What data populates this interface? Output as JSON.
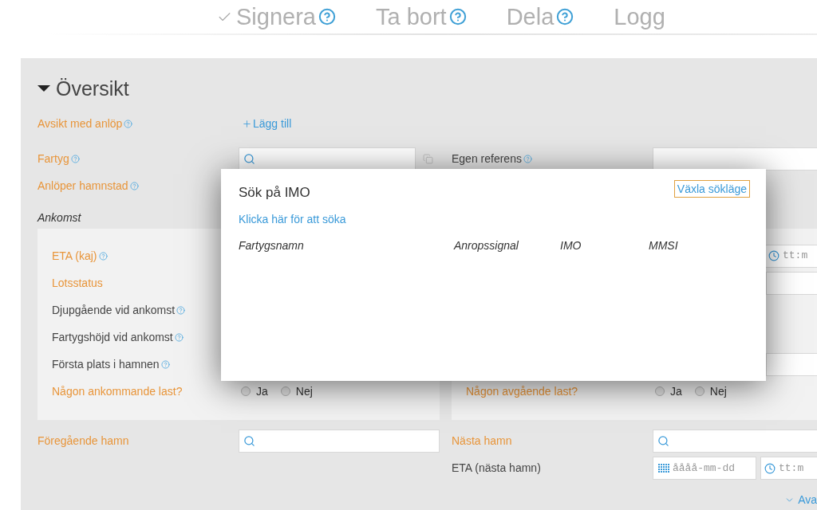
{
  "toolbar": {
    "actions": [
      {
        "label": "Signera",
        "checked": true,
        "help": true
      },
      {
        "label": "Ta bort",
        "checked": false,
        "help": true
      },
      {
        "label": "Dela",
        "checked": false,
        "help": true
      },
      {
        "label": "Logg",
        "checked": false,
        "help": false
      }
    ]
  },
  "section": {
    "title": "Översikt",
    "expanded": true,
    "rows": [
      {
        "left": {
          "label": "Avsikt med anlöp",
          "required": true,
          "help": true,
          "control": {
            "kind": "add",
            "label": "Lägg till"
          }
        }
      },
      {
        "left": {
          "label": "Fartyg",
          "required": true,
          "help": true,
          "control": {
            "kind": "search",
            "copy_button": true
          }
        },
        "right": {
          "label": "Egen referens",
          "required": false,
          "help": true,
          "control": {
            "kind": "text"
          }
        }
      },
      {
        "left": {
          "label": "Anlöper hamnstad",
          "required": true,
          "help": true
        }
      }
    ],
    "arrival": {
      "title": "Ankomst",
      "fields": [
        {
          "label": "ETA (kaj)",
          "required": true,
          "help": true
        },
        {
          "label": "Lotsstatus",
          "required": true,
          "help": false
        },
        {
          "label": "Djupgående vid ankomst",
          "required": false,
          "help": true
        },
        {
          "label": "Fartygshöjd vid ankomst",
          "required": false,
          "help": true
        },
        {
          "label": "Första plats i hamnen",
          "required": false,
          "help": true
        },
        {
          "label": "Någon ankommande last?",
          "required": true,
          "help": false,
          "control": {
            "kind": "radio",
            "options": [
              {
                "label": "Ja",
                "selected": false
              },
              {
                "label": "Nej",
                "selected": false
              }
            ]
          }
        }
      ]
    },
    "departure": {
      "fields": [
        {
          "control": {
            "kind": "time",
            "placeholder": "tt:m"
          }
        },
        {
          "control": {
            "kind": "text"
          }
        },
        {
          "control": {
            "kind": "text"
          }
        },
        {
          "label": "Någon avgående last?",
          "required": true,
          "help": false,
          "control": {
            "kind": "radio",
            "options": [
              {
                "label": "Ja",
                "selected": false
              },
              {
                "label": "Nej",
                "selected": false
              }
            ]
          }
        }
      ]
    },
    "bottom_rows": [
      {
        "left": {
          "label": "Föregående hamn",
          "required": true,
          "help": false,
          "control": {
            "kind": "search",
            "copy_button": false
          }
        },
        "right": {
          "label": "Nästa hamn",
          "required": true,
          "help": false,
          "control": {
            "kind": "search",
            "copy_button": false
          }
        }
      },
      {
        "right": {
          "label": "ETA (nästa hamn)",
          "required": false,
          "help": false,
          "control": {
            "kind": "datetime",
            "date": {
              "placeholder": "åååå-mm-dd"
            },
            "time": {
              "placeholder": "tt:m"
            }
          }
        }
      }
    ],
    "more_link": {
      "label": "Ava"
    }
  },
  "dialog": {
    "title": "Sök på IMO",
    "mode_toggle": {
      "label": "Växla sökläge",
      "focused": true
    },
    "search_link": "Klicka här för att söka",
    "columns": [
      "Fartygsnamn",
      "Anropssignal",
      "IMO",
      "MMSI"
    ]
  }
}
